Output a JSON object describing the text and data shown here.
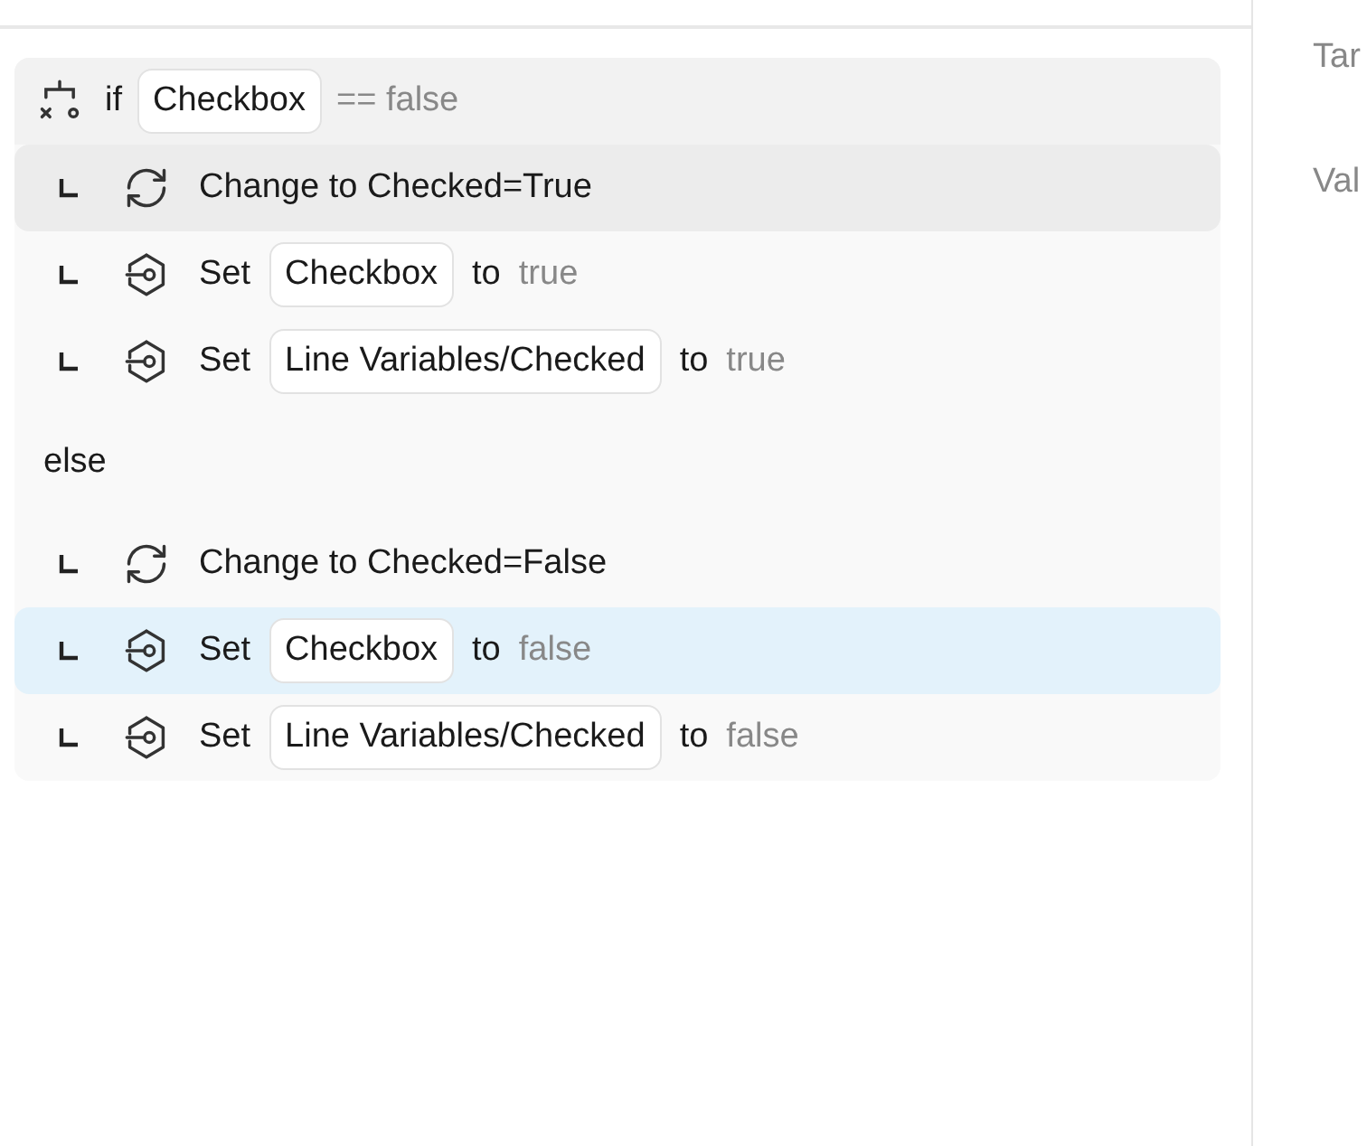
{
  "rows": [
    {
      "kind": "if",
      "keyword": "if",
      "variable": "Checkbox",
      "condition": "== false"
    },
    {
      "kind": "change",
      "text": "Change to Checked=True",
      "hovered": true,
      "selected": false
    },
    {
      "kind": "set",
      "verb": "Set",
      "target": "Checkbox",
      "connector": "to",
      "value": "true",
      "hovered": false,
      "selected": false
    },
    {
      "kind": "set",
      "verb": "Set",
      "target": "Line Variables/Checked",
      "connector": "to",
      "value": "true",
      "hovered": false,
      "selected": false
    },
    {
      "kind": "else",
      "text": "else"
    },
    {
      "kind": "change",
      "text": "Change to Checked=False",
      "hovered": false,
      "selected": false
    },
    {
      "kind": "set",
      "verb": "Set",
      "target": "Checkbox",
      "connector": "to",
      "value": "false",
      "hovered": false,
      "selected": true
    },
    {
      "kind": "set",
      "verb": "Set",
      "target": "Line Variables/Checked",
      "connector": "to",
      "value": "false",
      "hovered": false,
      "selected": false
    }
  ],
  "properties": {
    "labels": [
      "Tar",
      "Val"
    ]
  }
}
